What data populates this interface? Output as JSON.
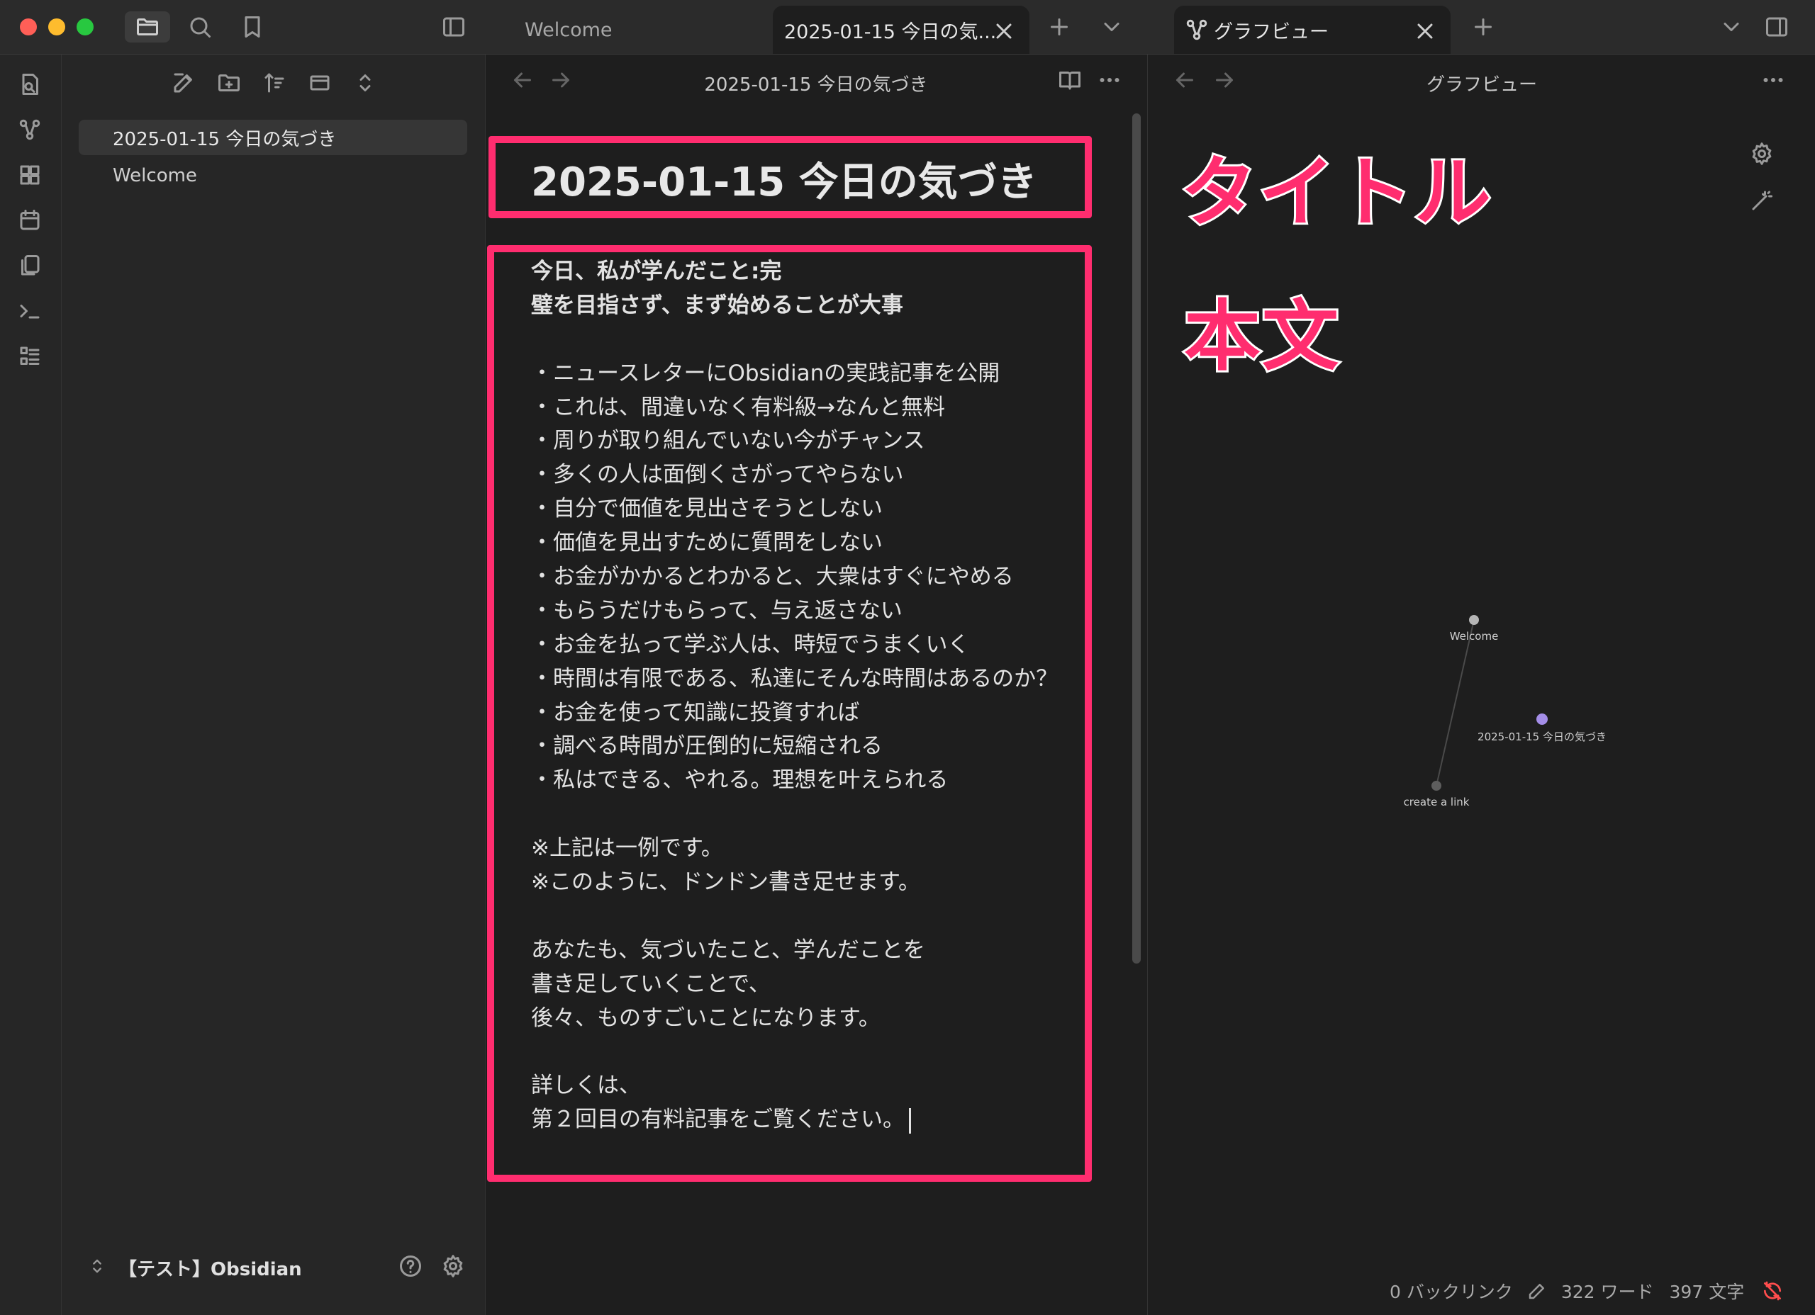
{
  "tabs": {
    "welcome": "Welcome",
    "note": "2025-01-15 今日の気...",
    "graph": "グラフビュー"
  },
  "sidebar": {
    "files": [
      {
        "label": "2025-01-15 今日の気づき",
        "active": true
      },
      {
        "label": "Welcome",
        "active": false
      }
    ],
    "vault_name": "【テスト】Obsidian"
  },
  "editor": {
    "view_title": "2025-01-15 今日の気づき",
    "note_title": "2025-01-15 今日の気づき",
    "body_lines": [
      "今日、私が学んだこと:完",
      "璧を目指さず、まず始めることが大事",
      "",
      "・ニュースレターにObsidianの実践記事を公開",
      "・これは、間違いなく有料級→なんと無料",
      "・周りが取り組んでいない今がチャンス",
      "・多くの人は面倒くさがってやらない",
      "・自分で価値を見出さそうとしない",
      "・価値を見出すために質問をしない",
      "・お金がかかるとわかると、大衆はすぐにやめる",
      "・もらうだけもらって、与え返さない",
      "・お金を払って学ぶ人は、時短でうまくいく",
      "・時間は有限である、私達にそんな時間はあるのか？",
      "・お金を使って知識に投資すれば",
      "・調べる時間が圧倒的に短縮される",
      "・私はできる、やれる。理想を叶えられる",
      "",
      "※上記は一例です。",
      "※このように、ドンドン書き足せます。",
      "",
      "あなたも、気づいたこと、学んだことを",
      "書き足していくことで、",
      "後々、ものすごいことになります。",
      "",
      "詳しくは、",
      "第２回目の有料記事をご覧ください。"
    ]
  },
  "graph": {
    "view_title": "グラフビュー",
    "nodes": [
      {
        "label": "Welcome",
        "color": "#b5b5b5"
      },
      {
        "label": "2025-01-15 今日の気づき",
        "color": "#a48ee8"
      },
      {
        "label": "create a link",
        "color": "#5e5e5e"
      }
    ]
  },
  "annotations": {
    "title_label": "タイトル",
    "body_label": "本文"
  },
  "statusbar": {
    "backlinks": "0 バックリンク",
    "words": "322 ワード",
    "chars": "397 文字"
  },
  "colors": {
    "accent_highlight": "#ff2d6f",
    "background": "#1e1e1e",
    "sidebar": "#262626",
    "graph_active_node": "#a48ee8"
  }
}
